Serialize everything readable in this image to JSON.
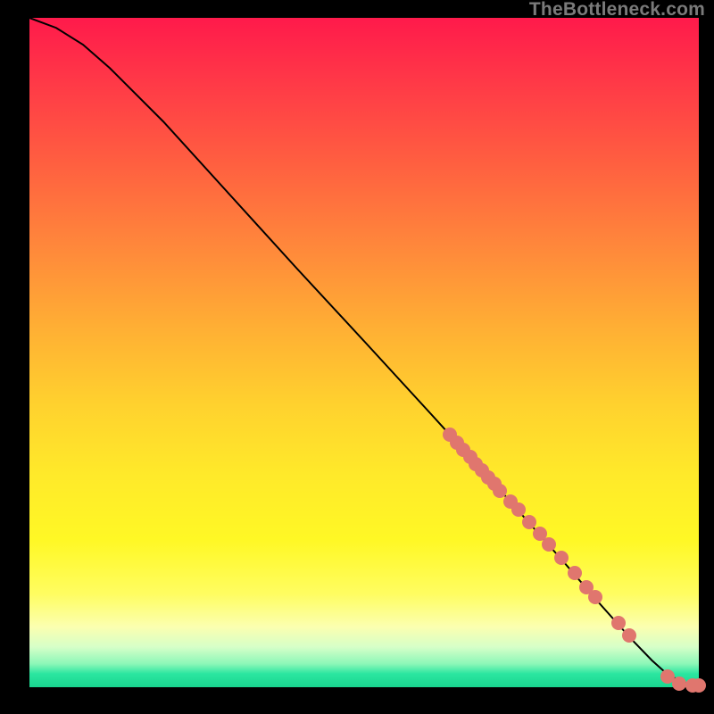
{
  "attribution": "TheBottleneck.com",
  "chart_data": {
    "type": "line",
    "title": "",
    "xlabel": "",
    "ylabel": "",
    "xlim": [
      0,
      100
    ],
    "ylim": [
      0,
      100
    ],
    "curve": {
      "name": "bottleneck-curve",
      "x": [
        0,
        4,
        8,
        12,
        20,
        30,
        40,
        50,
        60,
        70,
        80,
        85,
        90,
        93,
        95,
        97,
        99,
        100
      ],
      "y": [
        100,
        98.5,
        96,
        92.5,
        84.5,
        73.5,
        62.5,
        51.7,
        40.8,
        29.8,
        18.5,
        12.7,
        7.1,
        4.0,
        2.2,
        1.0,
        0.3,
        0.3
      ]
    },
    "series": [
      {
        "name": "highlight-dots",
        "x": [
          62.8,
          63.8,
          64.8,
          65.8,
          66.7,
          67.6,
          68.5,
          69.4,
          70.3,
          71.8,
          73.0,
          74.6,
          76.2,
          77.6,
          79.5,
          81.4,
          83.2,
          84.5,
          88.0,
          89.6,
          95.3,
          97.0,
          99.0,
          100.0
        ],
        "y": [
          37.7,
          36.6,
          35.5,
          34.4,
          33.4,
          32.4,
          31.4,
          30.4,
          29.4,
          27.8,
          26.5,
          24.7,
          22.9,
          21.4,
          19.3,
          17.1,
          15.0,
          13.5,
          9.6,
          7.8,
          1.6,
          0.6,
          0.3,
          0.3
        ]
      }
    ]
  }
}
